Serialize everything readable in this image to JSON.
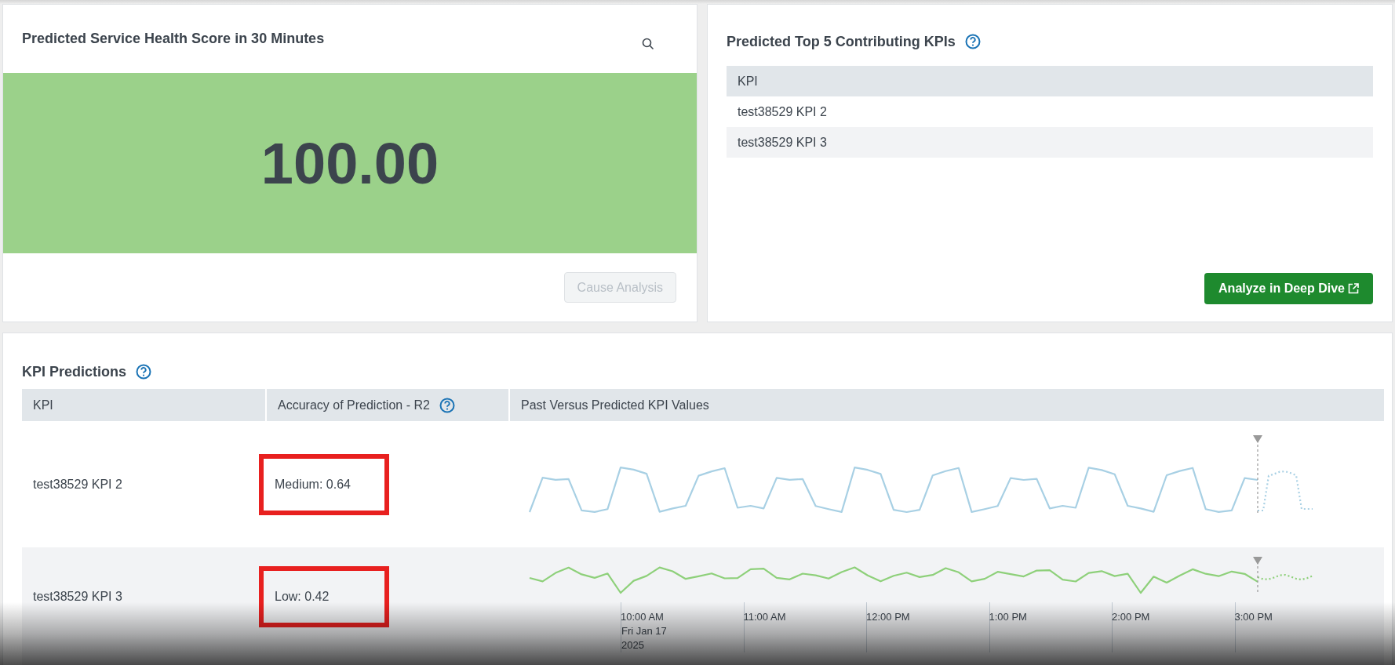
{
  "health_panel": {
    "title": "Predicted Service Health Score in 30 Minutes",
    "score": "100.00",
    "button": {
      "label": "Cause Analysis",
      "disabled": true
    }
  },
  "contributing_panel": {
    "title": "Predicted Top 5 Contributing KPIs",
    "table": {
      "columns": [
        "KPI"
      ],
      "rows": [
        [
          "test38529 KPI 2"
        ],
        [
          "test38529 KPI 3"
        ]
      ]
    },
    "button": {
      "label": "Analyze in Deep Dive"
    }
  },
  "predictions_panel": {
    "title": "KPI Predictions",
    "table": {
      "columns": [
        "KPI",
        "Accuracy of Prediction - R2",
        "Past Versus Predicted KPI Values"
      ],
      "rows": [
        {
          "kpi": "test38529 KPI 2",
          "accuracy": "Medium: 0.64",
          "highlighted": true,
          "color": "#a8d0e4"
        },
        {
          "kpi": "test38529 KPI 3",
          "accuracy": "Low: 0.42",
          "highlighted": true,
          "color": "#8ed07a"
        }
      ]
    },
    "time_axis": [
      {
        "label": "10:00 AM",
        "sub": [
          "Fri Jan 17",
          "2025"
        ]
      },
      {
        "label": "11:00 AM"
      },
      {
        "label": "12:00 PM"
      },
      {
        "label": "1:00 PM"
      },
      {
        "label": "2:00 PM"
      },
      {
        "label": "3:00 PM"
      }
    ]
  }
}
